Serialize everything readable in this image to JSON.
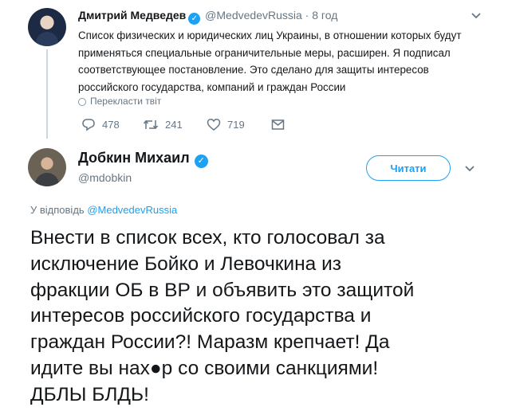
{
  "parent_tweet": {
    "author_name": "Дмитрий Медведев",
    "handle": "@MedvedevRussia",
    "dot": "·",
    "time": "8 год",
    "text": "Список физических и юридических лиц Украины, в отношении которых будут применяться специальные ограничительные меры, расширен. Я подписал соответствующее постановление. Это сделано для защиты интересов российского государства, компаний и граждан России",
    "translate_label": "Перекласти твіт",
    "replies": "478",
    "retweets": "241",
    "likes": "719"
  },
  "reply_tweet": {
    "author_name": "Добкин Михаил",
    "handle": "@mdobkin",
    "follow_label": "Читати",
    "reply_prefix": "У відповідь",
    "reply_mention": "@MedvedevRussia",
    "text": "Внести в список всех, кто голосовал за\nисключение Бойко и Левочкина из\nфракции ОБ в ВР и объявить это защитой\nинтересов российского государства и\nграждан России?! Маразм крепчает! Да\nидите вы нах●р со своими санкциями!\nДБЛЫ БЛДЬ!"
  },
  "colors": {
    "accent": "#1da1f2",
    "secondary_text": "#657786",
    "primary_text": "#14171a"
  },
  "icons": [
    "reply-icon",
    "retweet-icon",
    "like-icon",
    "message-icon",
    "verified-icon",
    "globe-icon",
    "chevron-down-icon"
  ]
}
